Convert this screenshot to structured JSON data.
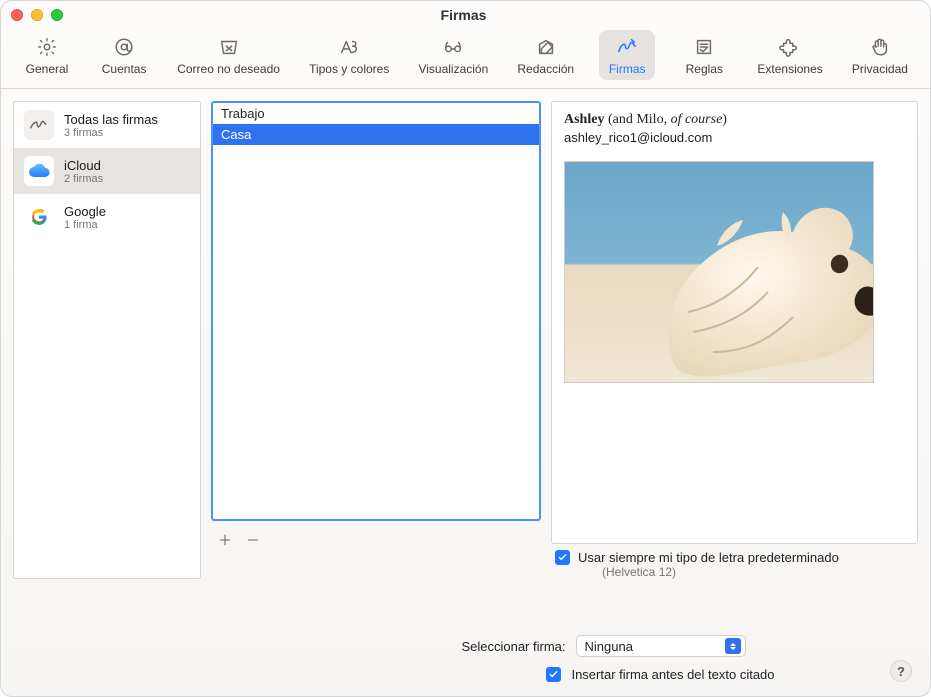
{
  "window": {
    "title": "Firmas"
  },
  "toolbar": [
    {
      "label": "General"
    },
    {
      "label": "Cuentas"
    },
    {
      "label": "Correo no deseado"
    },
    {
      "label": "Tipos y colores"
    },
    {
      "label": "Visualización"
    },
    {
      "label": "Redacción"
    },
    {
      "label": "Firmas"
    },
    {
      "label": "Reglas"
    },
    {
      "label": "Extensiones"
    },
    {
      "label": "Privacidad"
    }
  ],
  "accounts": [
    {
      "name": "Todas las firmas",
      "count_label": "3 firmas"
    },
    {
      "name": "iCloud",
      "count_label": "2 firmas"
    },
    {
      "name": "Google",
      "count_label": "1 firma"
    }
  ],
  "signatures": [
    "Trabajo",
    "Casa"
  ],
  "preview": {
    "owner_name": "Ashley",
    "aside_prefix": "and Milo",
    "aside_em": "of course",
    "email": "ashley_rico1@icloud.com"
  },
  "options": {
    "use_default_font_label": "Usar siempre mi tipo de letra predeterminado",
    "default_font_hint": "Helvetica 12",
    "choose_signature_label": "Seleccionar firma:",
    "choose_signature_value": "Ninguna",
    "place_above_label": "Insertar firma antes del texto citado"
  }
}
